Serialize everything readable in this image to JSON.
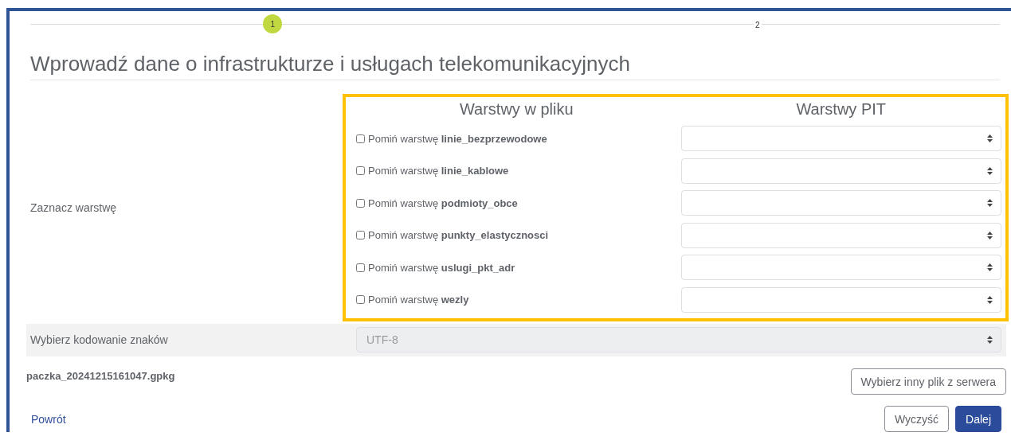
{
  "stepper": [
    {
      "label": "1",
      "selected": true
    },
    {
      "label": "2",
      "selected": false
    }
  ],
  "title": "Wprowadź dane o infrastrukturze i usługach telekomunikacyjnych",
  "layers": {
    "label": "Zaznacz warstwę",
    "file_column": "Warstwy w pliku",
    "pit_column": "Warstwy PIT",
    "rows": [
      {
        "label": "Pomiń warstwę **linie_bezprzewodowe**",
        "checked": false
      },
      {
        "label": "Pomiń warstwę **linie_kablowe**",
        "checked": false
      },
      {
        "label": "Pomiń warstwę **podmioty_obce**",
        "checked": false
      },
      {
        "label": "Pomiń warstwę **punkty_elastycznosci**",
        "checked": false
      },
      {
        "label": "Pomiń warstwę **uslugi_pkt_adr**",
        "checked": false
      },
      {
        "label": "Pomiń warstwę **wezly**",
        "checked": false
      }
    ]
  },
  "encoding": {
    "label": "Wybierz kodowanie znaków",
    "value": "UTF-8",
    "disabled": true
  },
  "file_name": "paczka_20241215161047.gpkg",
  "choose_file_button": "Wybierz inny plik z serwera",
  "back_link": "Powrót",
  "clear_button": "Wyczyść",
  "next_button": "Dalej"
}
